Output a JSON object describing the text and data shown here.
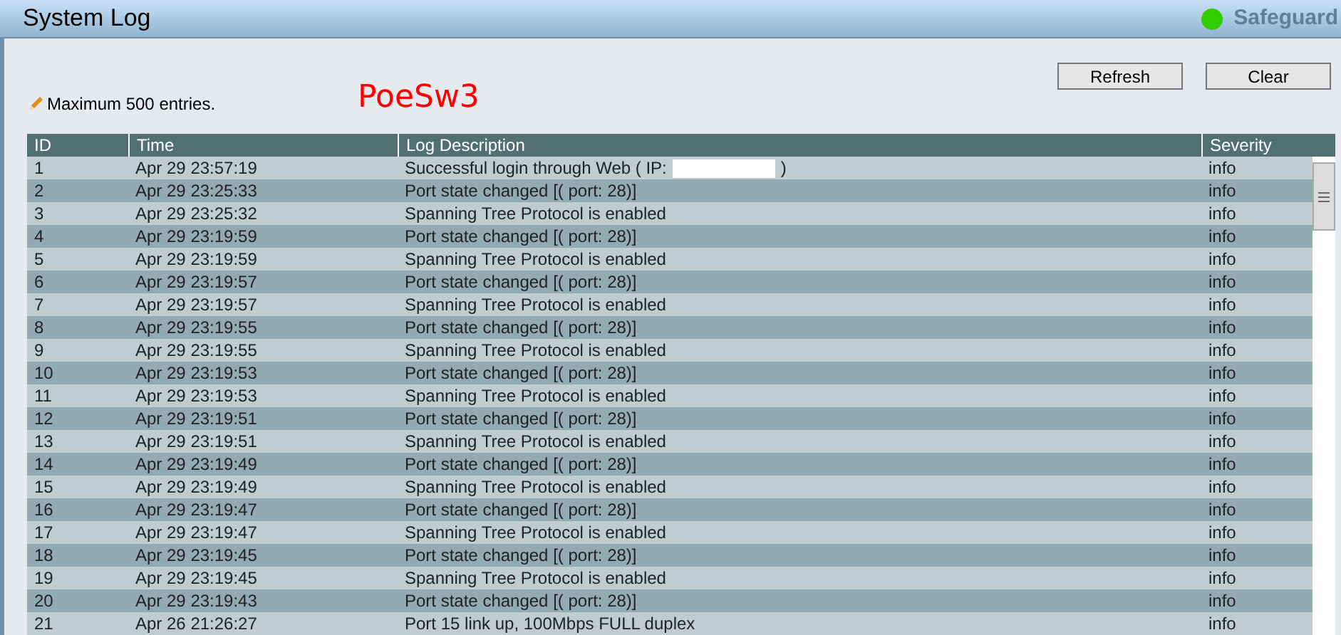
{
  "title": "System Log",
  "status": {
    "label": "Safeguard",
    "color": "#33cc00"
  },
  "buttons": [
    "Refresh",
    "Clear"
  ],
  "note": "Maximum 500 entries.",
  "overlay_label": "PoeSw3",
  "columns": [
    "ID",
    "Time",
    "Log Description",
    "Severity"
  ],
  "rows": [
    {
      "id": "1",
      "time": "Apr 29 23:57:19",
      "description": "Successful login through Web ( IP:",
      "redacted": true,
      "description_end": ")",
      "severity": "info"
    },
    {
      "id": "2",
      "time": "Apr 29 23:25:33",
      "description": "Port state changed [( port: 28)]",
      "redacted": false,
      "severity": "info"
    },
    {
      "id": "3",
      "time": "Apr 29 23:25:32",
      "description": "Spanning Tree Protocol is enabled",
      "redacted": false,
      "severity": "info"
    },
    {
      "id": "4",
      "time": "Apr 29 23:19:59",
      "description": "Port state changed [( port: 28)]",
      "redacted": false,
      "severity": "info"
    },
    {
      "id": "5",
      "time": "Apr 29 23:19:59",
      "description": "Spanning Tree Protocol is enabled",
      "redacted": false,
      "severity": "info"
    },
    {
      "id": "6",
      "time": "Apr 29 23:19:57",
      "description": "Port state changed [( port: 28)]",
      "redacted": false,
      "severity": "info"
    },
    {
      "id": "7",
      "time": "Apr 29 23:19:57",
      "description": "Spanning Tree Protocol is enabled",
      "redacted": false,
      "severity": "info"
    },
    {
      "id": "8",
      "time": "Apr 29 23:19:55",
      "description": "Port state changed [( port: 28)]",
      "redacted": false,
      "severity": "info"
    },
    {
      "id": "9",
      "time": "Apr 29 23:19:55",
      "description": "Spanning Tree Protocol is enabled",
      "redacted": false,
      "severity": "info"
    },
    {
      "id": "10",
      "time": "Apr 29 23:19:53",
      "description": "Port state changed [( port: 28)]",
      "redacted": false,
      "severity": "info"
    },
    {
      "id": "11",
      "time": "Apr 29 23:19:53",
      "description": "Spanning Tree Protocol is enabled",
      "redacted": false,
      "severity": "info"
    },
    {
      "id": "12",
      "time": "Apr 29 23:19:51",
      "description": "Port state changed [( port: 28)]",
      "redacted": false,
      "severity": "info"
    },
    {
      "id": "13",
      "time": "Apr 29 23:19:51",
      "description": "Spanning Tree Protocol is enabled",
      "redacted": false,
      "severity": "info"
    },
    {
      "id": "14",
      "time": "Apr 29 23:19:49",
      "description": "Port state changed [( port: 28)]",
      "redacted": false,
      "severity": "info"
    },
    {
      "id": "15",
      "time": "Apr 29 23:19:49",
      "description": "Spanning Tree Protocol is enabled",
      "redacted": false,
      "severity": "info"
    },
    {
      "id": "16",
      "time": "Apr 29 23:19:47",
      "description": "Port state changed [( port: 28)]",
      "redacted": false,
      "severity": "info"
    },
    {
      "id": "17",
      "time": "Apr 29 23:19:47",
      "description": "Spanning Tree Protocol is enabled",
      "redacted": false,
      "severity": "info"
    },
    {
      "id": "18",
      "time": "Apr 29 23:19:45",
      "description": "Port state changed [( port: 28)]",
      "redacted": false,
      "severity": "info"
    },
    {
      "id": "19",
      "time": "Apr 29 23:19:45",
      "description": "Spanning Tree Protocol is enabled",
      "redacted": false,
      "severity": "info"
    },
    {
      "id": "20",
      "time": "Apr 29 23:19:43",
      "description": "Port state changed [( port: 28)]",
      "redacted": false,
      "severity": "info"
    },
    {
      "id": "21",
      "time": "Apr 26 21:26:27",
      "description": "Port 15 link up, 100Mbps FULL duplex",
      "redacted": false,
      "severity": "info"
    }
  ]
}
